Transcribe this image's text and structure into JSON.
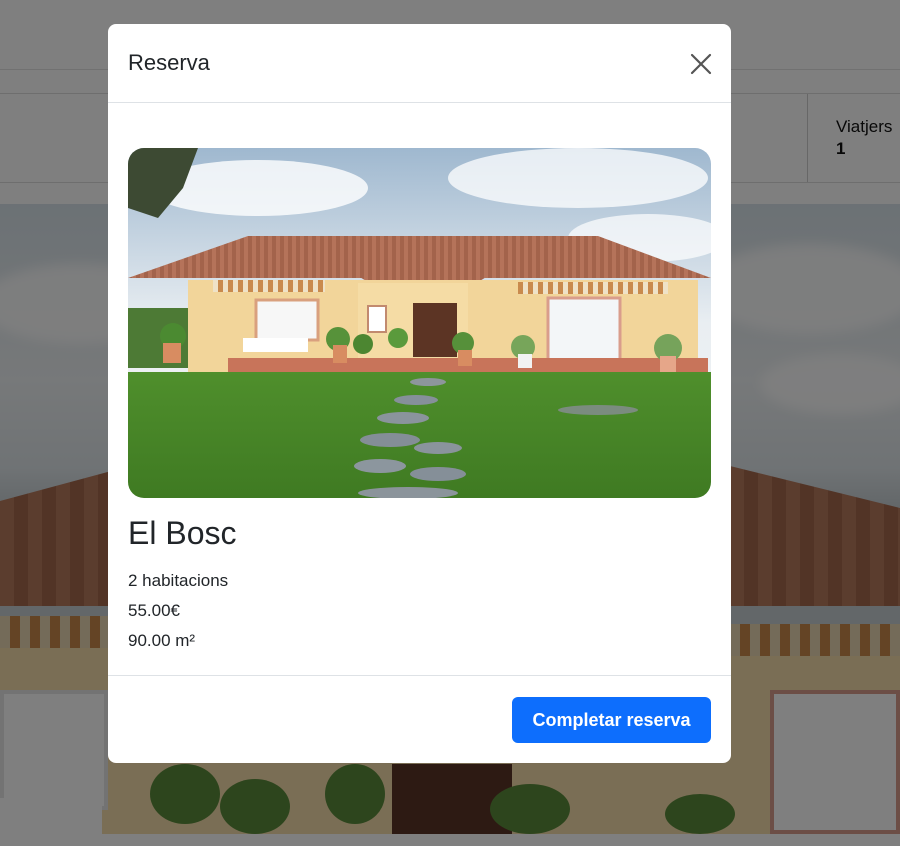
{
  "background": {
    "search_field_label": "Viatjers",
    "search_field_value": "1"
  },
  "modal": {
    "title": "Reserva",
    "close_icon": "close-icon",
    "room": {
      "name": "El Bosc",
      "rooms": "2 habitacions",
      "price": "55.00€",
      "area": "90.00 m²"
    },
    "complete_label": "Completar reserva"
  },
  "colors": {
    "primary_button": "#0d6efd",
    "overlay": "rgba(0,0,0,0.5)"
  }
}
